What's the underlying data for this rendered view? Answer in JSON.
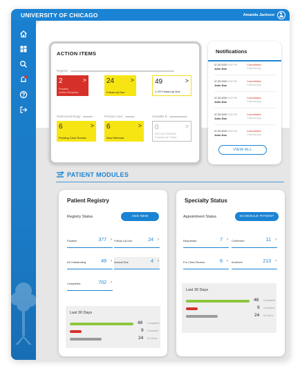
{
  "header": {
    "brand": "UNIVERSITY OF CHICAGO",
    "user_name": "Amanda Jackson",
    "accent": "#1b83d3"
  },
  "sidebar": {
    "items": [
      {
        "icon": "home-icon"
      },
      {
        "icon": "dashboard-icon"
      },
      {
        "icon": "search-icon"
      },
      {
        "icon": "notifications-icon",
        "badge": true
      },
      {
        "icon": "help-icon"
      },
      {
        "icon": "logout-icon"
      }
    ]
  },
  "action_items": {
    "title": "ACTION ITEMS",
    "groups": {
      "registry": "Registry",
      "gastro": "Gastroenterology",
      "primary": "Primary Care",
      "hep": "Hepatitis B"
    },
    "tiles": [
      {
        "value": "2",
        "label": "Positive\nAction Required"
      },
      {
        "value": "24",
        "label": "Follow-Up Due"
      },
      {
        "value": "49",
        "label": "1-YR Follow-Up Due"
      },
      {
        "value": "6",
        "label": "Pending Clinic Review"
      },
      {
        "value": "6",
        "label": "New Referrals"
      },
      {
        "value": "0",
        "label": "NOT ACTIVATED\nContact our Team"
      }
    ],
    "arrow": ">"
  },
  "notifications": {
    "title": "Notifications",
    "items": [
      {
        "date": "07-30-2020",
        "time": "9:00 PM",
        "name": "John Doe",
        "status": "Cancellation",
        "detail": "Colonoscopy"
      },
      {
        "date": "07-30-2020",
        "time": "9:00 PM",
        "name": "John Doe",
        "status": "Cancellation",
        "detail": "Colonoscopy"
      },
      {
        "date": "07-30-2020",
        "time": "9:00 PM",
        "name": "John Doe",
        "status": "Cancellation",
        "detail": "Colonoscopy"
      },
      {
        "date": "07-30-2020",
        "time": "9:00 PM",
        "name": "John Doe",
        "status": "Cancellation",
        "detail": "Colonoscopy"
      },
      {
        "date": "07-30-2020",
        "time": "9:00 PM",
        "name": "John Doe",
        "status": "Cancellation",
        "detail": "Colonoscopy"
      }
    ],
    "view_all": "VIEW ALL"
  },
  "modules": {
    "title": "PATIENT MODULES"
  },
  "registry": {
    "title": "Patient Registry",
    "subtitle": "Registry Status",
    "button": "ADD NEW",
    "stats": [
      {
        "label": "Positive",
        "value": "377"
      },
      {
        "label": "Follow-Up Due",
        "value": "24"
      },
      {
        "label": "All Outstanding",
        "value": "49"
      },
      {
        "label": "Annual Due",
        "value": "4"
      },
      {
        "label": "Completed",
        "value": "702"
      }
    ],
    "last30": {
      "title": "Last 30 Days",
      "rows": [
        {
          "value": 48,
          "label": "Completed",
          "color": "#8dc63f"
        },
        {
          "value": 9,
          "label": "Cancelled",
          "color": "#d63129"
        },
        {
          "value": 24,
          "label": "No Show",
          "color": "#9b9b9b"
        }
      ]
    }
  },
  "specialty": {
    "title": "Specialty Status",
    "subtitle": "Appointment Status",
    "button": "SCHEDULE PATIENT",
    "stats": [
      {
        "label": "Requested",
        "value": "7"
      },
      {
        "label": "Confirmed",
        "value": "11"
      },
      {
        "label": "For Clinic Review",
        "value": "6"
      },
      {
        "label": "Archived",
        "value": "213"
      }
    ],
    "last30": {
      "title": "Last 30 Days",
      "rows": [
        {
          "value": 48,
          "label": "Completed",
          "color": "#8dc63f"
        },
        {
          "value": 9,
          "label": "Cancelled",
          "color": "#d63129"
        },
        {
          "value": 24,
          "label": "No Show",
          "color": "#9b9b9b"
        }
      ]
    }
  }
}
